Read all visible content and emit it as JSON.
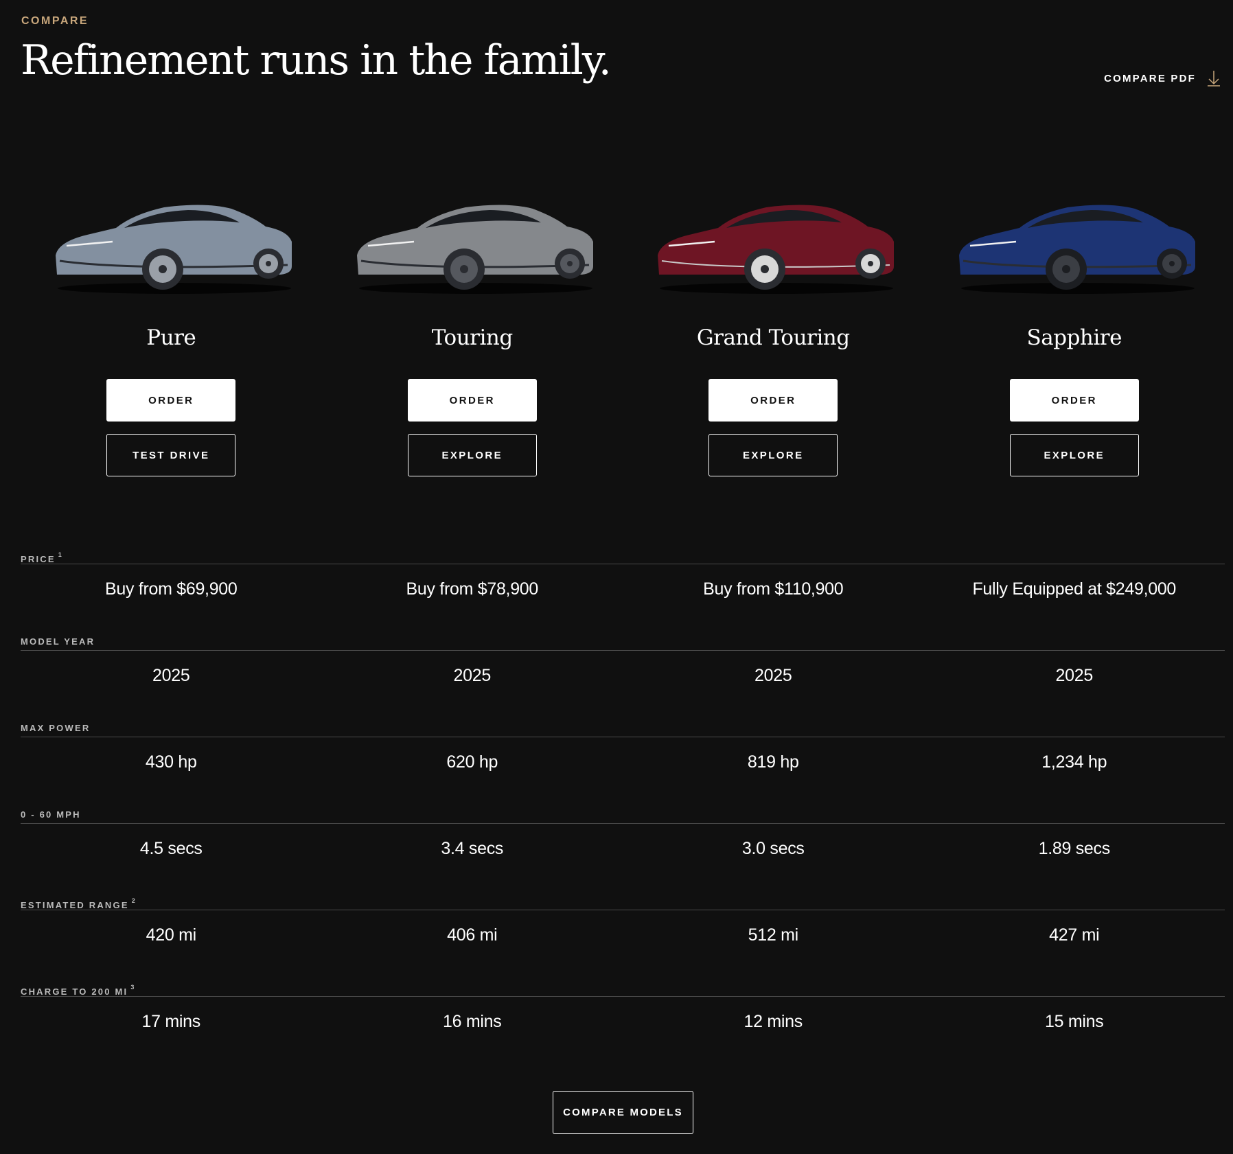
{
  "header": {
    "eyebrow": "COMPARE",
    "title": "Refinement runs in the family.",
    "pdf_label": "COMPARE PDF",
    "pdf_icon": "download-icon"
  },
  "colors": {
    "background": "#101010",
    "accent": "#c9a77c",
    "text": "#ffffff"
  },
  "models": [
    {
      "name": "Pure",
      "paint": "#8390a0",
      "primary_label": "ORDER",
      "secondary_label": "TEST DRIVE"
    },
    {
      "name": "Touring",
      "paint": "#85888c",
      "primary_label": "ORDER",
      "secondary_label": "EXPLORE"
    },
    {
      "name": "Grand Touring",
      "paint": "#6e1524",
      "primary_label": "ORDER",
      "secondary_label": "EXPLORE"
    },
    {
      "name": "Sapphire",
      "paint": "#1d3474",
      "primary_label": "ORDER",
      "secondary_label": "EXPLORE"
    }
  ],
  "specs": [
    {
      "label": "PRICE",
      "note": "1",
      "values": [
        "Buy from $69,900",
        "Buy from $78,900",
        "Buy from $110,900",
        "Fully Equipped at $249,000"
      ]
    },
    {
      "label": "MODEL YEAR",
      "note": "",
      "values": [
        "2025",
        "2025",
        "2025",
        "2025"
      ]
    },
    {
      "label": "MAX POWER",
      "note": "",
      "values": [
        "430 hp",
        "620 hp",
        "819 hp",
        "1,234 hp"
      ]
    },
    {
      "label": "0 - 60 MPH",
      "note": "",
      "values": [
        "4.5 secs",
        "3.4 secs",
        "3.0 secs",
        "1.89 secs"
      ]
    },
    {
      "label": "ESTIMATED RANGE",
      "note": "2",
      "values": [
        "420 mi",
        "406 mi",
        "512 mi",
        "427 mi"
      ]
    },
    {
      "label": "CHARGE TO 200 MI",
      "note": "3",
      "values": [
        "17 mins",
        "16 mins",
        "12 mins",
        "15 mins"
      ]
    }
  ],
  "footer": {
    "compare_label": "COMPARE MODELS"
  }
}
